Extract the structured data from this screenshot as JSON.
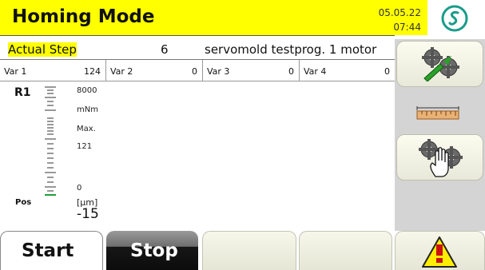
{
  "header": {
    "title": "Homing Mode",
    "date": "05.05.22",
    "time": "07:44",
    "accent_color": "#ffff00",
    "logo_icon": "s-swirl-logo"
  },
  "step": {
    "label": "Actual Step",
    "value": "6",
    "program": "servomold testprog. 1 motor"
  },
  "vars": [
    {
      "label": "Var 1",
      "value": "124"
    },
    {
      "label": "Var 2",
      "value": "0"
    },
    {
      "label": "Var 3",
      "value": "0"
    },
    {
      "label": "Var 4",
      "value": "0"
    }
  ],
  "gauge": {
    "name": "R1",
    "max_value": "8000",
    "unit": "mNm",
    "max_label": "Max.",
    "current_max": "121",
    "min_value": "0"
  },
  "position": {
    "label": "Pos",
    "unit": "[µm]",
    "value": "-15"
  },
  "right_panel": {
    "buttons": [
      {
        "icon": "gears-with-green-arrow-icon"
      },
      {
        "icon": "ruler-icon"
      },
      {
        "icon": "gears-with-hand-icon"
      }
    ]
  },
  "bottom_bar": {
    "start_label": "Start",
    "stop_label": "Stop",
    "warning_icon": "warning-triangle-icon"
  }
}
